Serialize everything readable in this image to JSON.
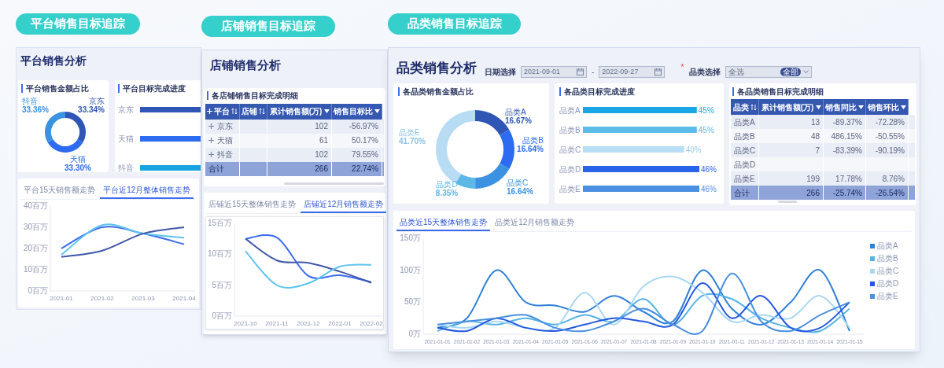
{
  "platform": {
    "pill": "平台销售目标追踪",
    "title": "平台销售分析",
    "share_card": {
      "title": "平台销售金额占比",
      "chart_data": {
        "type": "donut",
        "categories": [
          "京东",
          "天猫",
          "抖音"
        ],
        "series": [
          {
            "values": [
              33.34,
              33.3,
              33.36
            ]
          }
        ],
        "value_labels": [
          "33.34%",
          "33.30%",
          "33.36%"
        ]
      }
    },
    "progress_card": {
      "title": "平台目标完成进度",
      "bars": [
        {
          "label": "京东",
          "color": "#2f55b5"
        },
        {
          "label": "天猫",
          "color": "#2d6cf0"
        },
        {
          "label": "抖音",
          "color": "#1aa3e3"
        }
      ]
    },
    "trend_card": {
      "tabs": [
        {
          "label": "平台15天销售额走势",
          "selected": false
        },
        {
          "label": "平台近12月整体销售走势",
          "selected": true
        }
      ],
      "chart_data": {
        "type": "line",
        "categories": [
          "2021-01",
          "2021-02",
          "2021-03",
          "2021-04"
        ],
        "ylim": [
          0,
          40
        ],
        "yticks": [
          {
            "value": 0,
            "label": "0百万"
          },
          {
            "value": 10,
            "label": "10百万"
          },
          {
            "value": 20,
            "label": "20百万"
          },
          {
            "value": 30,
            "label": "30百万"
          },
          {
            "value": 40,
            "label": "40百万"
          }
        ],
        "series": [
          {
            "color": "#3b6cf0",
            "values": [
              20,
              30,
              27,
              22
            ]
          },
          {
            "color": "#5fc4ee",
            "values": [
              17,
              31,
              27,
              25
            ]
          },
          {
            "color": "#3e57a8",
            "values": [
              16,
              19,
              27,
              30
            ]
          }
        ]
      }
    }
  },
  "store": {
    "pill": "店铺销售目标追踪",
    "title": "店铺销售分析",
    "table_card": {
      "title": "各店铺销售目标完成明细",
      "columns": [
        {
          "label": "平台",
          "kind": "sortable"
        },
        {
          "label": "店铺",
          "kind": "sortable"
        },
        {
          "label": "累计销售额(万)",
          "kind": "filterable"
        },
        {
          "label": "销售目标比",
          "kind": "filterable"
        }
      ],
      "rows": [
        {
          "kind": "group",
          "expanded": false,
          "cells": [
            "京东",
            "",
            "102",
            "-56.97%"
          ]
        },
        {
          "kind": "group",
          "expanded": false,
          "cells": [
            "天猫",
            "",
            "61",
            "50.17%"
          ]
        },
        {
          "kind": "group",
          "expanded": false,
          "cells": [
            "抖音",
            "",
            "102",
            "79.55%"
          ]
        },
        {
          "kind": "total",
          "cells": [
            "合计",
            "",
            "266",
            "22.74%"
          ]
        }
      ]
    },
    "trend_card": {
      "tabs": [
        {
          "label": "店铺近15天整体销售走势",
          "selected": false
        },
        {
          "label": "店铺近12月销售额走势",
          "selected": true
        }
      ],
      "chart_data": {
        "type": "line",
        "categories": [
          "2021-10",
          "2021-11",
          "2021-12",
          "2022-01",
          "2022-02"
        ],
        "ylim": [
          0,
          15
        ],
        "yticks": [
          {
            "value": 0,
            "label": "0百万"
          },
          {
            "value": 5,
            "label": "5百万"
          },
          {
            "value": 10,
            "label": "10百万"
          },
          {
            "value": 15,
            "label": "15百万"
          }
        ],
        "series": [
          {
            "color": "#3b6cf0",
            "values": [
              12.5,
              12.7,
              6.5,
              6.6,
              5.5
            ]
          },
          {
            "color": "#3e57a8",
            "values": [
              12.5,
              9,
              8.6,
              7.2,
              5.4
            ]
          },
          {
            "color": "#5fc4ee",
            "values": [
              10.5,
              5,
              5.3,
              8,
              8.3
            ]
          }
        ]
      }
    }
  },
  "category": {
    "pill": "品类销售目标追踪",
    "title": "品类销售分析",
    "filters": {
      "date_label": "日期选择",
      "start_date": "2021-09-01",
      "separator": "-",
      "end_date": "2022-09-27",
      "required_mark": "*",
      "category_label": "品类选择",
      "category_value": "全选",
      "category_badge": "全部"
    },
    "share_card": {
      "title": "各品类销售金额占比",
      "chart_data": {
        "type": "donut",
        "categories": [
          "品类A",
          "品类B",
          "品类C",
          "品类D",
          "品类E"
        ],
        "series": [
          {
            "values": [
              16.67,
              16.64,
              16.64,
              8.35,
              41.7
            ]
          }
        ],
        "value_labels": [
          "16.67%",
          "16.64%",
          "16.64%",
          "8.35%",
          "41.70%"
        ]
      }
    },
    "progress_card": {
      "title": "各品类目标完成进度",
      "chart_data": {
        "type": "bar",
        "orientation": "horizontal",
        "categories": [
          "品类A",
          "品类B",
          "品类C",
          "品类D",
          "品类E"
        ],
        "values": [
          45,
          45,
          40,
          46,
          46
        ],
        "value_labels": [
          "45%",
          "45%",
          "40%",
          "46%",
          "46%"
        ]
      }
    },
    "table_card": {
      "title": "各品类销售目标完成明细",
      "columns": [
        {
          "label": "品类",
          "kind": "sortable"
        },
        {
          "label": "累计销售额(万)",
          "kind": "filterable"
        },
        {
          "label": "销售同比",
          "kind": "filterable"
        },
        {
          "label": "销售环比",
          "kind": "filterable"
        }
      ],
      "rows": [
        {
          "kind": "item",
          "cells": [
            "品类A",
            "13",
            "-89.37%",
            "-72.28%"
          ]
        },
        {
          "kind": "item",
          "cells": [
            "品类B",
            "48",
            "486.15%",
            "-50.55%"
          ]
        },
        {
          "kind": "item",
          "cells": [
            "品类C",
            "7",
            "-83.39%",
            "-90.19%"
          ]
        },
        {
          "kind": "item",
          "cells": [
            "品类D",
            "",
            "",
            ""
          ]
        },
        {
          "kind": "item",
          "cells": [
            "品类E",
            "199",
            "17.78%",
            "8.76%"
          ]
        },
        {
          "kind": "total",
          "cells": [
            "合计",
            "266",
            "-25.74%",
            "-26.54%"
          ]
        }
      ]
    },
    "trend_card": {
      "tabs": [
        {
          "label": "品类近15天整体销售走势",
          "selected": true
        },
        {
          "label": "品类近12月销售额走势",
          "selected": false
        }
      ],
      "chart_data": {
        "type": "line",
        "categories": [
          "2021-01-01",
          "2021-01-02",
          "2021-01-03",
          "2021-01-04",
          "2021-01-05",
          "2021-01-06",
          "2021-01-07",
          "2021-01-08",
          "2021-01-09",
          "2021-01-10",
          "2021-01-11",
          "2021-01-12",
          "2021-01-13",
          "2021-01-14",
          "2021-01-15"
        ],
        "ylim": [
          0,
          150
        ],
        "yticks": [
          {
            "value": 0,
            "label": "0万"
          },
          {
            "value": 50,
            "label": "50万"
          },
          {
            "value": 100,
            "label": "100万"
          },
          {
            "value": 150,
            "label": "150万"
          }
        ],
        "series": [
          {
            "name": "品类A",
            "color": "#2f80d8",
            "values": [
              10,
              25,
              100,
              50,
              45,
              35,
              60,
              35,
              20,
              100,
              40,
              15,
              50,
              100,
              5
            ]
          },
          {
            "name": "品类B",
            "color": "#56b3e6",
            "values": [
              5,
              20,
              15,
              25,
              15,
              30,
              20,
              55,
              15,
              60,
              55,
              25,
              10,
              5,
              40
            ]
          },
          {
            "name": "品类C",
            "color": "#a9d8f2",
            "values": [
              15,
              10,
              20,
              10,
              10,
              65,
              15,
              75,
              90,
              65,
              20,
              30,
              25,
              60,
              10
            ]
          },
          {
            "name": "品类D",
            "color": "#2457e0",
            "values": [
              10,
              5,
              25,
              10,
              5,
              15,
              25,
              20,
              15,
              80,
              25,
              60,
              10,
              10,
              50
            ]
          },
          {
            "name": "品类E",
            "color": "#4a8fe0",
            "values": [
              15,
              20,
              25,
              30,
              10,
              5,
              20,
              40,
              15,
              5,
              95,
              20,
              5,
              30,
              50
            ]
          }
        ]
      }
    }
  }
}
